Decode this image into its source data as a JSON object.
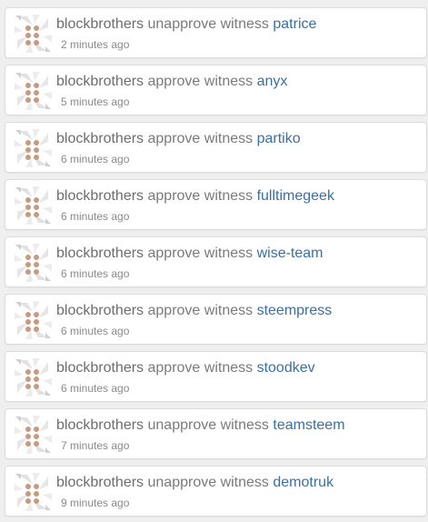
{
  "colors": {
    "page_background": "#efefef",
    "card_background": "#ffffff",
    "card_border": "#dcdcdc",
    "user_text": "#6d6d6d",
    "link": "#3b6fa3",
    "timestamp": "#8a8a8a",
    "avatar_dots": "#c89a80"
  },
  "avatar_icon": "pinwheel-identicon",
  "feed": {
    "items": [
      {
        "user": "blockbrothers",
        "action": "unapprove witness",
        "witness": "patrice",
        "time": "2 minutes ago"
      },
      {
        "user": "blockbrothers",
        "action": "approve witness",
        "witness": "anyx",
        "time": "5 minutes ago"
      },
      {
        "user": "blockbrothers",
        "action": "approve witness",
        "witness": "partiko",
        "time": "6 minutes ago"
      },
      {
        "user": "blockbrothers",
        "action": "approve witness",
        "witness": "fulltimegeek",
        "time": "6 minutes ago"
      },
      {
        "user": "blockbrothers",
        "action": "approve witness",
        "witness": "wise-team",
        "time": "6 minutes ago"
      },
      {
        "user": "blockbrothers",
        "action": "approve witness",
        "witness": "steempress",
        "time": "6 minutes ago"
      },
      {
        "user": "blockbrothers",
        "action": "approve witness",
        "witness": "stoodkev",
        "time": "6 minutes ago"
      },
      {
        "user": "blockbrothers",
        "action": "unapprove witness",
        "witness": "teamsteem",
        "time": "7 minutes ago"
      },
      {
        "user": "blockbrothers",
        "action": "unapprove witness",
        "witness": "demotruk",
        "time": "9 minutes ago"
      }
    ]
  }
}
